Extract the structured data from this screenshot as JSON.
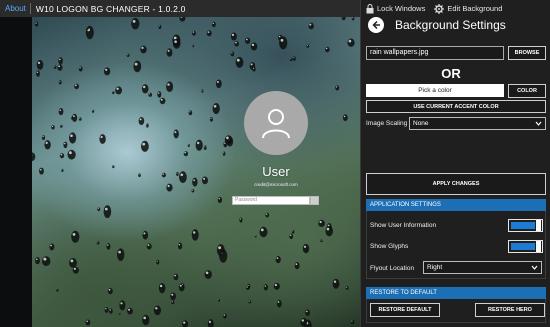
{
  "titlebar": {
    "about_label": "About",
    "app_title": "W10 LOGON BG CHANGER - 1.0.2.0"
  },
  "preview": {
    "user_name": "User",
    "user_email": "credit@microsoft.com",
    "password_placeholder": "Password"
  },
  "panel": {
    "lock_windows_label": "Lock Windows",
    "edit_background_label": "Edit Background",
    "title": "Background Settings",
    "file_name": "rain wallpapers.jpg",
    "browse_label": "BROWSE",
    "or_label": "OR",
    "pick_color_label": "Pick a color",
    "color_label": "COLOR",
    "use_accent_label": "USE CURRENT ACCENT COLOR",
    "image_scaling_label": "Image Scaling",
    "image_scaling_value": "None",
    "apply_label": "APPLY CHANGES"
  },
  "app_settings": {
    "header": "APPLICATION SETTINGS",
    "show_user_info_label": "Show User Information",
    "show_user_info_on": true,
    "show_glyphs_label": "Show Glyphs",
    "show_glyphs_on": true,
    "flyout_location_label": "Flyout Location",
    "flyout_location_value": "Right"
  },
  "restore": {
    "header": "RESTORE TO DEFAULT",
    "restore_default_label": "RESTORE DEFAULT",
    "restore_hero_label": "RESTORE HERO"
  },
  "colors": {
    "accent": "#1c6fb5",
    "toggle_on": "#1e7bd3",
    "panel_bg": "#1f1f1f",
    "link": "#5aa9ff"
  },
  "icons": {
    "lock": "lock-icon",
    "gear": "gear-icon",
    "back": "back-arrow-icon",
    "user": "user-icon",
    "chevron": "chevron-down-icon"
  }
}
